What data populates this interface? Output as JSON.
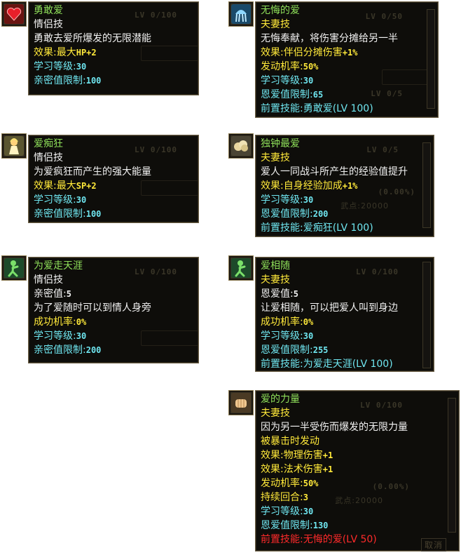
{
  "skills": {
    "s1": {
      "name": "勇敢爱",
      "type": "情侣技",
      "desc": "勇敢去爱所爆发的无限潜能",
      "effect_label": "效果:最大",
      "effect_value": "HP+2",
      "learn_label": "学习等级:",
      "learn_value": "30",
      "limit_label": "亲密值限制:",
      "limit_value": "100",
      "bg_level": "LV 0/100"
    },
    "s2": {
      "name": "爱痴狂",
      "type": "情侣技",
      "desc": "为爱疯狂而产生的强大能量",
      "effect_label": "效果:最大",
      "effect_value": "SP+2",
      "learn_label": "学习等级:",
      "learn_value": "30",
      "limit_label": "亲密值限制:",
      "limit_value": "100",
      "bg_level": "LV 0/100"
    },
    "s3": {
      "name": "为爱走天涯",
      "type": "情侣技",
      "intimacy_label": "亲密值:",
      "intimacy_value": "5",
      "desc": "为了爱随时可以到情人身旁",
      "rate_label": "成功机率:",
      "rate_value": "0%",
      "learn_label": "学习等级:",
      "learn_value": "30",
      "limit_label": "亲密值限制:",
      "limit_value": "200",
      "bg_level": "LV 0/100"
    },
    "s4": {
      "name": "无悔的爱",
      "type": "夫妻技",
      "desc": "无悔奉献，将伤害分摊给另一半",
      "effect_label": "效果:伴侣分摊伤害",
      "effect_value": "+1%",
      "rate_label": "发动机率:",
      "rate_value": "50%",
      "learn_label": "学习等级:",
      "learn_value": "30",
      "limit_label": "恩爱值限制:",
      "limit_value": "65",
      "pre_label": "前置技能:",
      "pre_value": "勇敢爱(LV 100)",
      "bg_level": "LV 0/50",
      "bg_level2": "LV 0/5"
    },
    "s5": {
      "name": "独钟最爱",
      "type": "夫妻技",
      "desc": "爱人一同战斗所产生的经验值提升",
      "effect_label": "效果:自身经验加成",
      "effect_value": "+1%",
      "learn_label": "学习等级:",
      "learn_value": "30",
      "limit_label": "恩爱值限制:",
      "limit_value": "200",
      "pre_label": "前置技能:",
      "pre_value": "爱痴狂(LV 100)",
      "bg_level": "LV 0/5",
      "bg_pct": "(0.00%)",
      "bg_pts": "武点:20000"
    },
    "s6": {
      "name": "爱相随",
      "type": "夫妻技",
      "love_label": "恩爱值:",
      "love_value": "5",
      "desc": "让爱相随，可以把爱人叫到身边",
      "rate_label": "成功机率:",
      "rate_value": "0%",
      "learn_label": "学习等级:",
      "learn_value": "30",
      "limit_label": "恩爱值限制:",
      "limit_value": "255",
      "pre_label": "前置技能:",
      "pre_value": "为爱走天涯(LV 100)",
      "bg_level": "LV 0/100"
    },
    "s7": {
      "name": "爱的力量",
      "type": "夫妻技",
      "desc": "因为另一半受伤而爆发的无限力量",
      "trigger": "被暴击时发动",
      "effect1_label": "效果:物理伤害",
      "effect1_value": "+1",
      "effect2_label": "效果:法术伤害",
      "effect2_value": "+1",
      "rate_label": "发动机率:",
      "rate_value": "50%",
      "dur_label": "持续回合:",
      "dur_value": "3",
      "learn_label": "学习等级:",
      "learn_value": "30",
      "limit_label": "恩爱值限制:",
      "limit_value": "130",
      "pre_label": "前置技能:",
      "pre_value": "无悔的爱(LV 50)",
      "bg_level": "LV 0/100",
      "bg_pct": "(0.00%)",
      "bg_pts": "武点:20000",
      "bg_cancel": "取消"
    }
  },
  "icons": {
    "s1": "heart-icon",
    "s2": "bride-icon",
    "s3": "walking-figure-icon",
    "s4": "jellyfish-icon",
    "s5": "cloud-icon",
    "s6": "walking-figure-icon",
    "s7": "fist-icon"
  },
  "colors": {
    "name": "#8fe05a",
    "text": "#f2f2f2",
    "stat": "#ffe93a",
    "req": "#6fe6f0",
    "unmet": "#ff2a2a",
    "panel_bg": "#0e0d0a"
  }
}
